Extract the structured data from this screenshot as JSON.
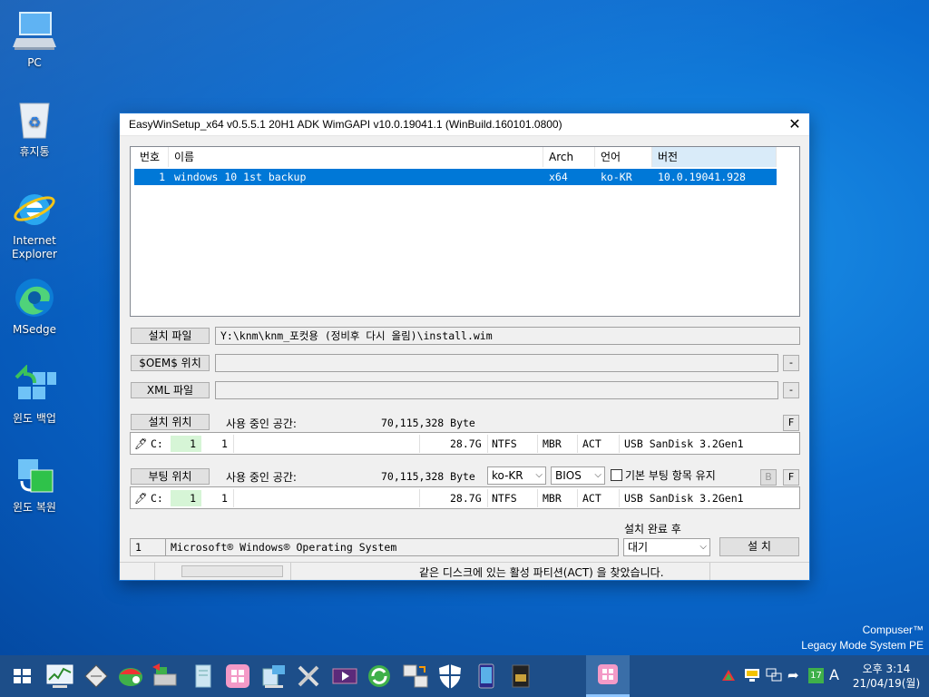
{
  "desktop": {
    "icons": [
      {
        "label": "PC"
      },
      {
        "label": "휴지통"
      },
      {
        "label": "Internet\nExplorer"
      },
      {
        "label": "MSedge"
      },
      {
        "label": "윈도 백업"
      },
      {
        "label": "윈도 복원"
      }
    ],
    "branding": {
      "line1": "Compuser™",
      "line2": "Legacy Mode System PE"
    }
  },
  "window": {
    "title": "EasyWinSetup_x64 v0.5.5.1    20H1 ADK    WimGAPI v10.0.19041.1 (WinBuild.160101.0800)",
    "close_label": "✕",
    "image_list": {
      "columns": [
        "번호",
        "이름",
        "Arch",
        "언어",
        "버전"
      ],
      "rows": [
        {
          "index": "1",
          "name": "windows 10 1st backup",
          "arch": "x64",
          "lang": "ko-KR",
          "version": "10.0.19041.928"
        }
      ]
    },
    "install_file": {
      "button": "설치 파일",
      "value": "Y:\\knm\\knm_포컷용 (정비후 다시 올림)\\install.wim"
    },
    "oem": {
      "button": "$OEM$ 위치",
      "value": "",
      "side": "-"
    },
    "xml": {
      "button": "XML 파일",
      "value": "",
      "side": "-"
    },
    "install_location": {
      "button": "설치 위치",
      "used_label": "사용 중인 공간:",
      "used_value": "70,115,328 Byte",
      "f_label": "F",
      "row": {
        "drive": "C:",
        "disk": "1",
        "part": "1",
        "size": "28.7G",
        "fs": "NTFS",
        "table": "MBR",
        "flag": "ACT",
        "device": "USB SanDisk 3.2Gen1"
      }
    },
    "boot_location": {
      "button": "부팅 위치",
      "used_label": "사용 중인 공간:",
      "used_value": "70,115,328 Byte",
      "lang_select": "ko-KR",
      "firmware_select": "BIOS",
      "keep_checkbox_label": "기본 부팅 항목 유지",
      "b_label": "B",
      "f_label": "F",
      "row": {
        "drive": "C:",
        "disk": "1",
        "part": "1",
        "size": "28.7G",
        "fs": "NTFS",
        "table": "MBR",
        "flag": "ACT",
        "device": "USB SanDisk 3.2Gen1"
      }
    },
    "os_index": "1",
    "os_name": "Microsoft® Windows® Operating System",
    "after_install_label": "설치 완료 후",
    "after_install_select": "대기",
    "install_button": "설 치",
    "status_text": "같은 디스크에 있는 활성 파티션(ACT) 을 찾았습니다."
  },
  "taskbar": {
    "tray_badge": "17",
    "ime": "A",
    "clock_time": "오후 3:14",
    "clock_date": "21/04/19(월)"
  },
  "colors": {
    "selection": "#0078d7",
    "taskbar": "#1d4e89",
    "accent": "#1a73d1"
  }
}
